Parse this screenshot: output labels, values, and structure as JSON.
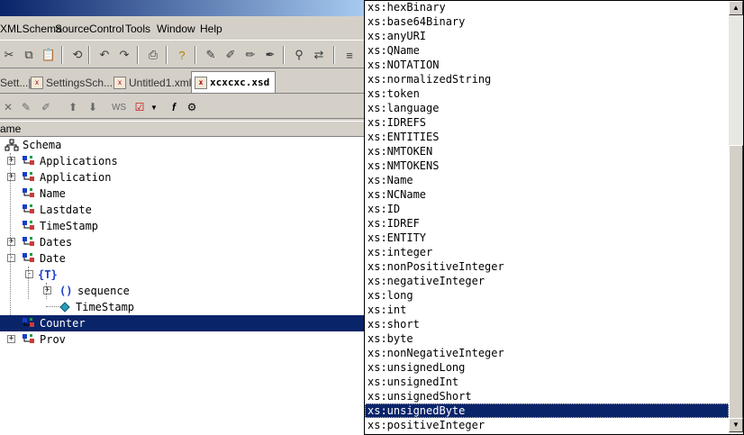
{
  "menu": {
    "xmlschema": "XMLSchema",
    "sourcecontrol": "SourceControl",
    "tools": "Tools",
    "window": "Window",
    "help": "Help"
  },
  "tabs": [
    {
      "label": "Sett...|"
    },
    {
      "label": "SettingsSch...|"
    },
    {
      "label": "Untitled1.xml *"
    },
    {
      "label": "xcxcxc.xsd"
    }
  ],
  "toolbar2": {
    "ws_label": "WS"
  },
  "column_header": "ame",
  "tree": [
    {
      "label": "Schema",
      "icon": "schema-icon",
      "expander": ""
    },
    {
      "label": "Applications",
      "icon": "element-icon",
      "expander": "+"
    },
    {
      "label": "Application",
      "icon": "element-icon",
      "expander": "+"
    },
    {
      "label": "Name",
      "icon": "element-icon",
      "expander": ""
    },
    {
      "label": "Lastdate",
      "icon": "element-icon",
      "expander": ""
    },
    {
      "label": "TimeStamp",
      "icon": "element-icon",
      "expander": ""
    },
    {
      "label": "Dates",
      "icon": "element-icon",
      "expander": "+"
    },
    {
      "label": "Date",
      "icon": "element-icon",
      "expander": "-"
    },
    {
      "label": "{T}",
      "icon": "complex-type-icon",
      "expander": "-"
    },
    {
      "label": "sequence",
      "icon": "sequence-icon",
      "expander": "+"
    },
    {
      "label": "TimeStamp",
      "icon": "attribute-icon",
      "expander": ""
    },
    {
      "label": "Counter",
      "icon": "element-icon",
      "expander": "",
      "selected": true
    },
    {
      "label": "Prov",
      "icon": "element-icon",
      "expander": "+"
    }
  ],
  "types": [
    "xs:hexBinary",
    "xs:base64Binary",
    "xs:anyURI",
    "xs:QName",
    "xs:NOTATION",
    "xs:normalizedString",
    "xs:token",
    "xs:language",
    "xs:IDREFS",
    "xs:ENTITIES",
    "xs:NMTOKEN",
    "xs:NMTOKENS",
    "xs:Name",
    "xs:NCName",
    "xs:ID",
    "xs:IDREF",
    "xs:ENTITY",
    "xs:integer",
    "xs:nonPositiveInteger",
    "xs:negativeInteger",
    "xs:long",
    "xs:int",
    "xs:short",
    "xs:byte",
    "xs:nonNegativeInteger",
    "xs:unsignedLong",
    "xs:unsignedInt",
    "xs:unsignedShort",
    "xs:unsignedByte",
    "xs:positiveInteger"
  ],
  "selected_type": "xs:unsignedByte",
  "colors": {
    "selection": "#0a246a",
    "face": "#d4d0c8"
  }
}
